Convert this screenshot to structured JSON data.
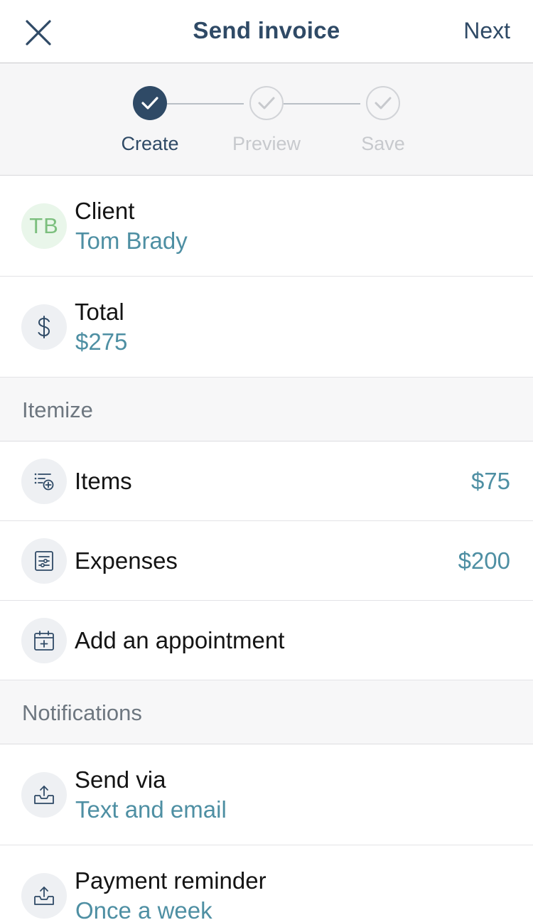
{
  "navbar": {
    "title": "Send invoice",
    "next_label": "Next",
    "close_icon": "close-icon"
  },
  "stepper": {
    "steps": [
      {
        "label": "Create",
        "state": "complete"
      },
      {
        "label": "Preview",
        "state": "pending"
      },
      {
        "label": "Save",
        "state": "pending"
      }
    ]
  },
  "client": {
    "label": "Client",
    "value": "Tom Brady",
    "initials": "TB"
  },
  "total": {
    "label": "Total",
    "value": "$275",
    "icon": "dollar-icon"
  },
  "itemize": {
    "title": "Itemize",
    "items": {
      "label": "Items",
      "amount": "$75",
      "icon": "list-add-icon"
    },
    "expenses": {
      "label": "Expenses",
      "amount": "$200",
      "icon": "receipt-icon"
    },
    "appointment": {
      "label": "Add an appointment",
      "icon": "calendar-add-icon"
    }
  },
  "notifications": {
    "title": "Notifications",
    "send_via": {
      "label": "Send via",
      "value": "Text and email",
      "icon": "send-tray-icon"
    },
    "payment_reminder": {
      "label": "Payment reminder",
      "value": "Once a week",
      "icon": "send-tray-icon"
    }
  },
  "colors": {
    "primary": "#2f4a66",
    "accent": "#4e8fa3",
    "avatar_bg": "#e9f6ea",
    "avatar_text": "#7cbf7e"
  }
}
